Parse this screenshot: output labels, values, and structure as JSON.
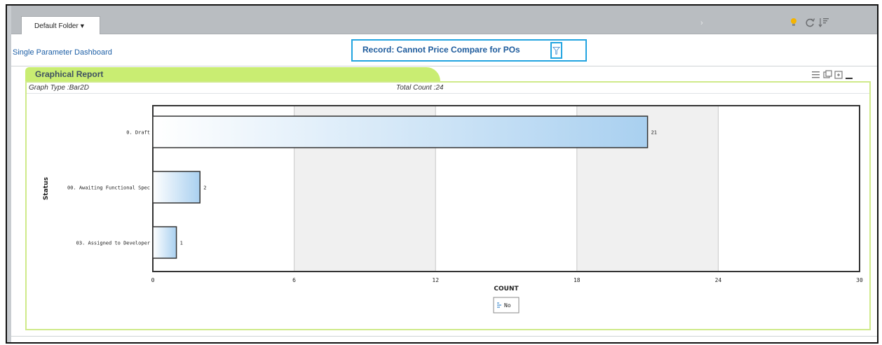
{
  "tabs": {
    "folder_label": "Default Folder",
    "folder_caret": "▼"
  },
  "toolbar": {
    "nav_arrow": "›",
    "icons": [
      "lightbulb-icon",
      "refresh-icon",
      "sort-icon"
    ]
  },
  "dashboard": {
    "link_label": "Single Parameter Dashboard"
  },
  "record": {
    "title": "Record: Cannot Price Compare for POs",
    "filter_icon": "filter-icon"
  },
  "panel": {
    "title": "Graphical Report",
    "graph_type": "Graph Type :Bar2D",
    "total_count": "Total Count :24",
    "tool_icons": [
      "list-icon",
      "export-icon",
      "expand-icon",
      "minimize-icon"
    ]
  },
  "colors": {
    "accent_green": "#c9ed72",
    "link_blue": "#1d5fa6",
    "highlight_blue": "#22a4e0",
    "bar_start": "#ffffff",
    "bar_end": "#a9d0f0"
  },
  "chart_data": {
    "type": "bar",
    "orientation": "horizontal",
    "categories": [
      "0. Draft",
      "00. Awaiting Functional Spec",
      "03. Assigned to Developer"
    ],
    "series": [
      {
        "name": "No",
        "values": [
          21,
          2,
          1
        ]
      }
    ],
    "data_labels": [
      "21",
      "2",
      "1"
    ],
    "xlabel": "COUNT",
    "ylabel": "Status",
    "xlim": [
      0,
      30
    ],
    "xticks": [
      "0",
      "6",
      "12",
      "18",
      "24",
      "30"
    ],
    "grid": "vertical alternating bands",
    "legend": "bottom-center"
  }
}
